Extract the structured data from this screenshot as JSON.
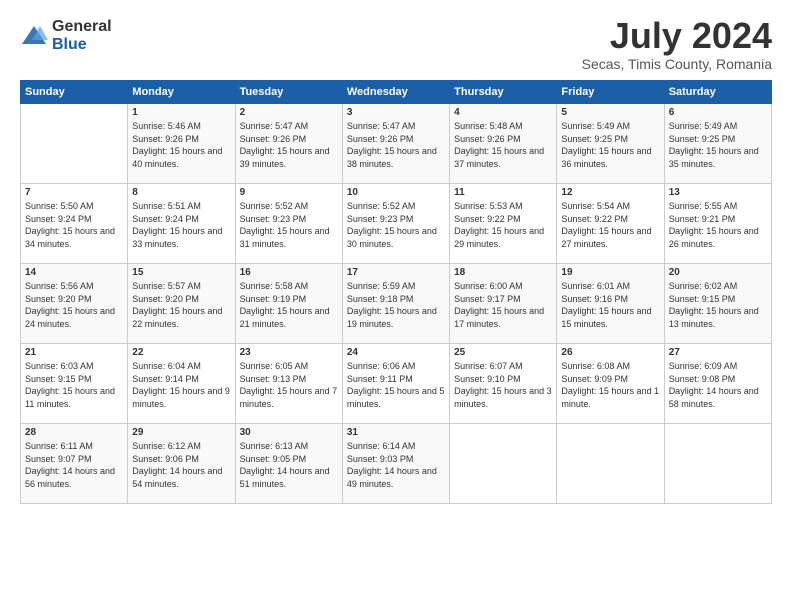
{
  "logo": {
    "general": "General",
    "blue": "Blue"
  },
  "title": {
    "month_year": "July 2024",
    "location": "Secas, Timis County, Romania"
  },
  "days_of_week": [
    "Sunday",
    "Monday",
    "Tuesday",
    "Wednesday",
    "Thursday",
    "Friday",
    "Saturday"
  ],
  "weeks": [
    [
      {
        "day": "",
        "sunrise": "",
        "sunset": "",
        "daylight": ""
      },
      {
        "day": "1",
        "sunrise": "Sunrise: 5:46 AM",
        "sunset": "Sunset: 9:26 PM",
        "daylight": "Daylight: 15 hours and 40 minutes."
      },
      {
        "day": "2",
        "sunrise": "Sunrise: 5:47 AM",
        "sunset": "Sunset: 9:26 PM",
        "daylight": "Daylight: 15 hours and 39 minutes."
      },
      {
        "day": "3",
        "sunrise": "Sunrise: 5:47 AM",
        "sunset": "Sunset: 9:26 PM",
        "daylight": "Daylight: 15 hours and 38 minutes."
      },
      {
        "day": "4",
        "sunrise": "Sunrise: 5:48 AM",
        "sunset": "Sunset: 9:26 PM",
        "daylight": "Daylight: 15 hours and 37 minutes."
      },
      {
        "day": "5",
        "sunrise": "Sunrise: 5:49 AM",
        "sunset": "Sunset: 9:25 PM",
        "daylight": "Daylight: 15 hours and 36 minutes."
      },
      {
        "day": "6",
        "sunrise": "Sunrise: 5:49 AM",
        "sunset": "Sunset: 9:25 PM",
        "daylight": "Daylight: 15 hours and 35 minutes."
      }
    ],
    [
      {
        "day": "7",
        "sunrise": "Sunrise: 5:50 AM",
        "sunset": "Sunset: 9:24 PM",
        "daylight": "Daylight: 15 hours and 34 minutes."
      },
      {
        "day": "8",
        "sunrise": "Sunrise: 5:51 AM",
        "sunset": "Sunset: 9:24 PM",
        "daylight": "Daylight: 15 hours and 33 minutes."
      },
      {
        "day": "9",
        "sunrise": "Sunrise: 5:52 AM",
        "sunset": "Sunset: 9:23 PM",
        "daylight": "Daylight: 15 hours and 31 minutes."
      },
      {
        "day": "10",
        "sunrise": "Sunrise: 5:52 AM",
        "sunset": "Sunset: 9:23 PM",
        "daylight": "Daylight: 15 hours and 30 minutes."
      },
      {
        "day": "11",
        "sunrise": "Sunrise: 5:53 AM",
        "sunset": "Sunset: 9:22 PM",
        "daylight": "Daylight: 15 hours and 29 minutes."
      },
      {
        "day": "12",
        "sunrise": "Sunrise: 5:54 AM",
        "sunset": "Sunset: 9:22 PM",
        "daylight": "Daylight: 15 hours and 27 minutes."
      },
      {
        "day": "13",
        "sunrise": "Sunrise: 5:55 AM",
        "sunset": "Sunset: 9:21 PM",
        "daylight": "Daylight: 15 hours and 26 minutes."
      }
    ],
    [
      {
        "day": "14",
        "sunrise": "Sunrise: 5:56 AM",
        "sunset": "Sunset: 9:20 PM",
        "daylight": "Daylight: 15 hours and 24 minutes."
      },
      {
        "day": "15",
        "sunrise": "Sunrise: 5:57 AM",
        "sunset": "Sunset: 9:20 PM",
        "daylight": "Daylight: 15 hours and 22 minutes."
      },
      {
        "day": "16",
        "sunrise": "Sunrise: 5:58 AM",
        "sunset": "Sunset: 9:19 PM",
        "daylight": "Daylight: 15 hours and 21 minutes."
      },
      {
        "day": "17",
        "sunrise": "Sunrise: 5:59 AM",
        "sunset": "Sunset: 9:18 PM",
        "daylight": "Daylight: 15 hours and 19 minutes."
      },
      {
        "day": "18",
        "sunrise": "Sunrise: 6:00 AM",
        "sunset": "Sunset: 9:17 PM",
        "daylight": "Daylight: 15 hours and 17 minutes."
      },
      {
        "day": "19",
        "sunrise": "Sunrise: 6:01 AM",
        "sunset": "Sunset: 9:16 PM",
        "daylight": "Daylight: 15 hours and 15 minutes."
      },
      {
        "day": "20",
        "sunrise": "Sunrise: 6:02 AM",
        "sunset": "Sunset: 9:15 PM",
        "daylight": "Daylight: 15 hours and 13 minutes."
      }
    ],
    [
      {
        "day": "21",
        "sunrise": "Sunrise: 6:03 AM",
        "sunset": "Sunset: 9:15 PM",
        "daylight": "Daylight: 15 hours and 11 minutes."
      },
      {
        "day": "22",
        "sunrise": "Sunrise: 6:04 AM",
        "sunset": "Sunset: 9:14 PM",
        "daylight": "Daylight: 15 hours and 9 minutes."
      },
      {
        "day": "23",
        "sunrise": "Sunrise: 6:05 AM",
        "sunset": "Sunset: 9:13 PM",
        "daylight": "Daylight: 15 hours and 7 minutes."
      },
      {
        "day": "24",
        "sunrise": "Sunrise: 6:06 AM",
        "sunset": "Sunset: 9:11 PM",
        "daylight": "Daylight: 15 hours and 5 minutes."
      },
      {
        "day": "25",
        "sunrise": "Sunrise: 6:07 AM",
        "sunset": "Sunset: 9:10 PM",
        "daylight": "Daylight: 15 hours and 3 minutes."
      },
      {
        "day": "26",
        "sunrise": "Sunrise: 6:08 AM",
        "sunset": "Sunset: 9:09 PM",
        "daylight": "Daylight: 15 hours and 1 minute."
      },
      {
        "day": "27",
        "sunrise": "Sunrise: 6:09 AM",
        "sunset": "Sunset: 9:08 PM",
        "daylight": "Daylight: 14 hours and 58 minutes."
      }
    ],
    [
      {
        "day": "28",
        "sunrise": "Sunrise: 6:11 AM",
        "sunset": "Sunset: 9:07 PM",
        "daylight": "Daylight: 14 hours and 56 minutes."
      },
      {
        "day": "29",
        "sunrise": "Sunrise: 6:12 AM",
        "sunset": "Sunset: 9:06 PM",
        "daylight": "Daylight: 14 hours and 54 minutes."
      },
      {
        "day": "30",
        "sunrise": "Sunrise: 6:13 AM",
        "sunset": "Sunset: 9:05 PM",
        "daylight": "Daylight: 14 hours and 51 minutes."
      },
      {
        "day": "31",
        "sunrise": "Sunrise: 6:14 AM",
        "sunset": "Sunset: 9:03 PM",
        "daylight": "Daylight: 14 hours and 49 minutes."
      },
      {
        "day": "",
        "sunrise": "",
        "sunset": "",
        "daylight": ""
      },
      {
        "day": "",
        "sunrise": "",
        "sunset": "",
        "daylight": ""
      },
      {
        "day": "",
        "sunrise": "",
        "sunset": "",
        "daylight": ""
      }
    ]
  ]
}
